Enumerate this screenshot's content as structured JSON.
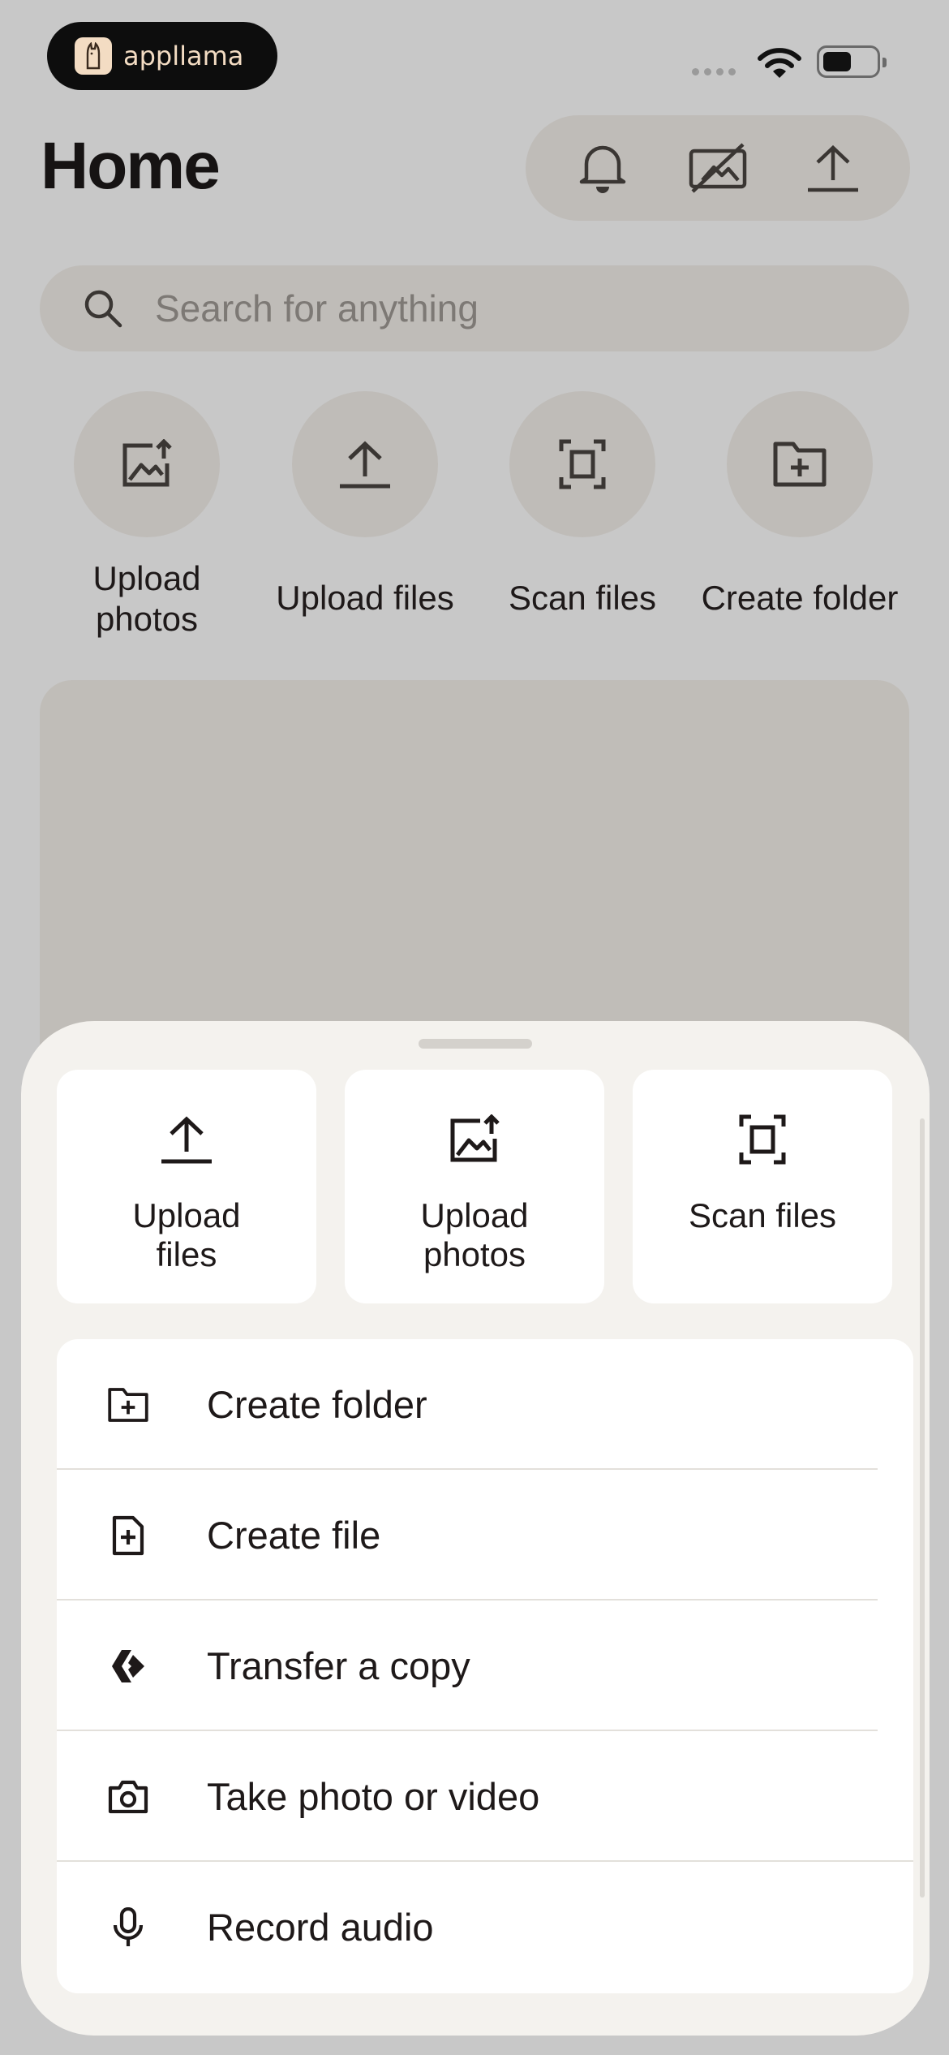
{
  "status_bar": {
    "brand": "appllama"
  },
  "header": {
    "title": "Home"
  },
  "search": {
    "placeholder": "Search for anything"
  },
  "quick_actions": [
    {
      "label": "Upload photos",
      "icon": "upload-photo-icon"
    },
    {
      "label": "Upload files",
      "icon": "upload-icon"
    },
    {
      "label": "Scan files",
      "icon": "scan-icon"
    },
    {
      "label": "Create folder",
      "icon": "folder-plus-icon"
    }
  ],
  "sheet": {
    "tiles": [
      {
        "label": "Upload files",
        "icon": "upload-icon"
      },
      {
        "label": "Upload photos",
        "icon": "upload-photo-icon"
      },
      {
        "label": "Scan files",
        "icon": "scan-icon"
      }
    ],
    "items": [
      {
        "label": "Create folder",
        "icon": "folder-plus-icon"
      },
      {
        "label": "Create file",
        "icon": "file-plus-icon"
      },
      {
        "label": "Transfer a copy",
        "icon": "transfer-icon"
      },
      {
        "label": "Take photo or video",
        "icon": "camera-icon"
      },
      {
        "label": "Record audio",
        "icon": "microphone-icon"
      }
    ]
  },
  "colors": {
    "scrim_background": "#c8c8c8",
    "sheet_background": "#f4f2ee",
    "card_background": "#ffffff",
    "text": "#1e1919"
  }
}
